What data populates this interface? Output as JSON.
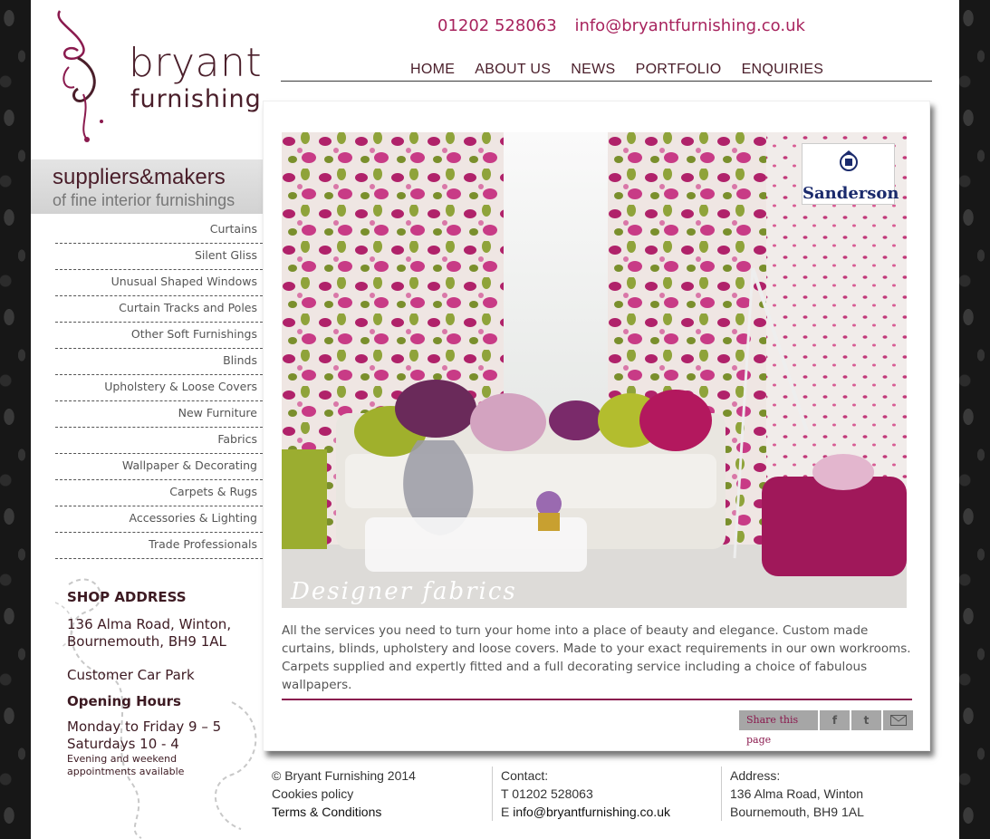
{
  "header": {
    "phone": "01202 528063",
    "email": "info@bryantfurnishing.co.uk"
  },
  "logo": {
    "line1": "bryant",
    "line2": "furnishing"
  },
  "tagline": {
    "line1": "suppliers&makers",
    "line2": "of fine interior furnishings"
  },
  "mainnav": [
    "HOME",
    "ABOUT US",
    "NEWS",
    "PORTFOLIO",
    "ENQUIRIES"
  ],
  "sidebar": {
    "items": [
      "Curtains",
      "Silent Gliss",
      "Unusual Shaped Windows",
      "Curtain Tracks and Poles",
      "Other Soft Furnishings",
      "Blinds",
      "Upholstery & Loose Covers",
      "New Furniture",
      "Fabrics",
      "Wallpaper & Decorating",
      "Carpets & Rugs",
      "Accessories & Lighting",
      "Trade Professionals"
    ]
  },
  "shop": {
    "heading": "SHOP ADDRESS",
    "address1": "136 Alma Road, Winton,",
    "address2": "Bournemouth, BH9 1AL",
    "parking": "Customer Car Park",
    "hours_heading": "Opening Hours",
    "hours1": "Monday to Friday 9 – 5",
    "hours2": "Saturdays 10 - 4",
    "note": "Evening and weekend appointments available"
  },
  "hero": {
    "caption": "Designer fabrics",
    "brand": "Sanderson"
  },
  "intro": "All the services you need to turn your home into a place of beauty and elegance. Custom made curtains, blinds, upholstery and loose covers. Made to your exact requirements in our own workrooms. Carpets supplied and expertly fitted and a full decorating service including a choice of fabulous wallpapers.",
  "share": {
    "label": "Share this page"
  },
  "footer": {
    "copyright": "© Bryant Furnishing 2014",
    "cookies": "Cookies policy",
    "terms": "Terms & Conditions",
    "contact_heading": "Contact:",
    "contact_phone": "T 01202 528063",
    "contact_email_prefix": "E ",
    "contact_email": "info@bryantfurnishing.co.uk",
    "address_heading": "Address:",
    "address1": "136 Alma Road, Winton",
    "address2": "Bournemouth, BH9 1AL"
  },
  "colors": {
    "brand": "#4a1e2a",
    "accent": "#a8245e"
  }
}
